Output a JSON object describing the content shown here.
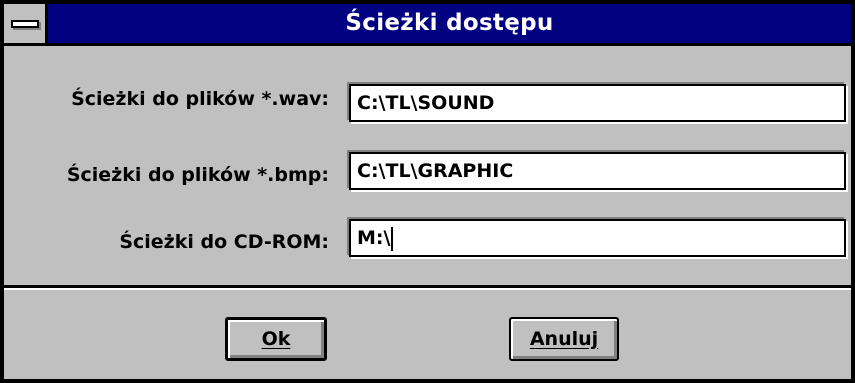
{
  "window": {
    "title": "Ścieżki dostępu"
  },
  "fields": [
    {
      "label": "Ścieżki do plików *.wav:",
      "value": "C:\\TL\\SOUND"
    },
    {
      "label": "Ścieżki do plików *.bmp:",
      "value": "C:\\TL\\GRAPHIC"
    },
    {
      "label": "Ścieżki do CD-ROM:",
      "value": "M:\\"
    }
  ],
  "buttons": {
    "ok_label": "Ok",
    "cancel_label": "Anuluj"
  },
  "colors": {
    "titlebar": "#000080",
    "face": "#c0c0c0",
    "field_background": "#ffffff"
  }
}
